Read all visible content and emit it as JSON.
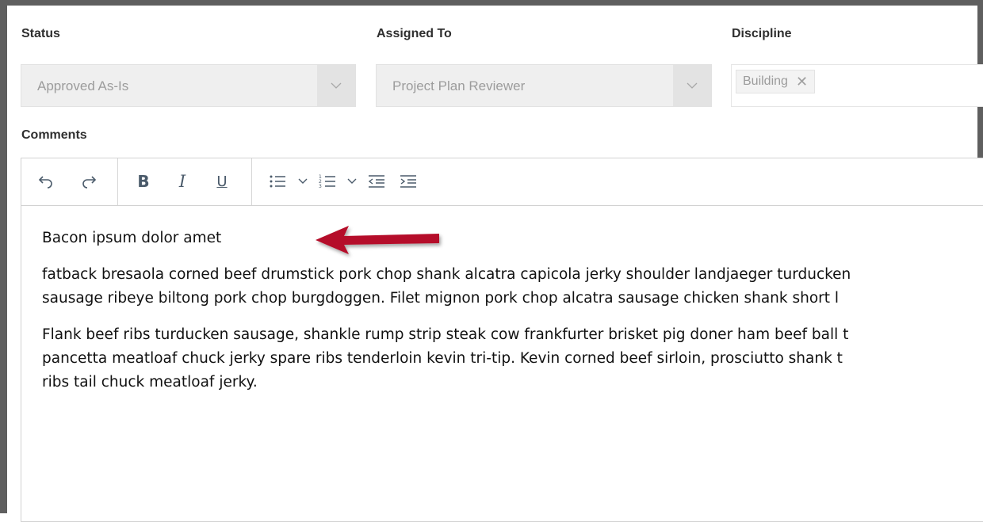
{
  "status": {
    "label": "Status",
    "value": "Approved As-Is"
  },
  "assigned_to": {
    "label": "Assigned To",
    "value": "Project Plan Reviewer"
  },
  "discipline": {
    "label": "Discipline",
    "tags": [
      "Building"
    ]
  },
  "comments": {
    "label": "Comments",
    "toolbar": {
      "icons": [
        "undo-icon",
        "redo-icon",
        "bold-icon",
        "italic-icon",
        "underline-icon",
        "bullet-list-icon",
        "chevron-down-icon",
        "numbered-list-icon",
        "chevron-down-icon",
        "outdent-icon",
        "indent-icon"
      ],
      "bold_glyph": "B",
      "italic_glyph": "I",
      "underline_glyph": "U"
    },
    "paragraphs": [
      "Bacon ipsum dolor amet",
      "fatback bresaola corned beef drumstick pork chop shank alcatra capicola jerky shoulder landjaeger turducken sausage ribeye biltong pork chop burgdoggen. Filet mignon pork chop alcatra sausage chicken shank short l",
      "Flank beef ribs turducken sausage, shankle rump strip steak cow frankfurter brisket pig doner ham beef ball t pancetta meatloaf chuck jerky spare ribs tenderloin kevin tri-tip. Kevin corned beef sirloin, prosciutto shank t ribs tail chuck meatloaf jerky."
    ],
    "lines": {
      "p1": [
        "Bacon ipsum dolor amet"
      ],
      "p2": [
        "fatback bresaola corned beef drumstick pork chop shank alcatra capicola jerky shoulder landjaeger turducken",
        "sausage ribeye biltong pork chop burgdoggen. Filet mignon pork chop alcatra sausage chicken shank short l"
      ],
      "p3": [
        "Flank beef ribs turducken sausage, shankle rump strip steak cow frankfurter brisket pig doner ham beef ball t",
        "pancetta meatloaf chuck jerky spare ribs tenderloin kevin tri-tip. Kevin corned beef sirloin, prosciutto shank t",
        "ribs tail chuck meatloaf jerky."
      ]
    }
  },
  "annotation": {
    "arrow_color": "#b5112a"
  }
}
